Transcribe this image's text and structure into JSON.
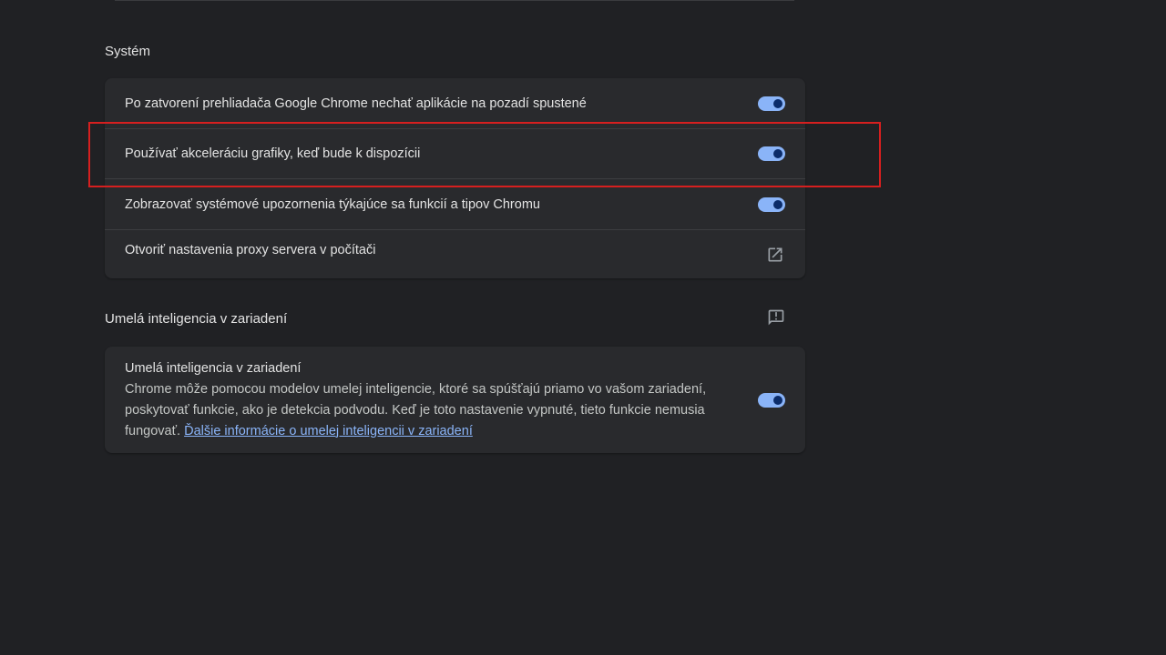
{
  "system": {
    "title": "Systém",
    "rows": [
      {
        "label": "Po zatvorení prehliadača Google Chrome nechať aplikácie na pozadí spustené",
        "enabled": true
      },
      {
        "label": "Používať akceleráciu grafiky, keď bude k dispozícii",
        "enabled": true
      },
      {
        "label": "Zobrazovať systémové upozornenia týkajúce sa funkcií a tipov Chromu",
        "enabled": true
      }
    ],
    "proxy_label": "Otvoriť nastavenia proxy servera v počítači",
    "proxy_icon": "open-in-new-icon"
  },
  "ai": {
    "title": "Umelá inteligencia v zariadení",
    "feedback_icon": "feedback-icon",
    "item_title": "Umelá inteligencia v zariadení",
    "item_desc": "Chrome môže pomocou modelov umelej inteligencie, ktoré sa spúšťajú priamo vo vašom zariadení, poskytovať funkcie, ako je detekcia podvodu. Keď je toto nastavenie vypnuté, tieto funkcie nemusia fungovať.",
    "item_link": "Ďalšie informácie o umelej inteligencii v zariadení",
    "enabled": true
  },
  "colors": {
    "background": "#202124",
    "card": "#292a2d",
    "accent": "#8ab4f8",
    "highlight": "#d61f1f"
  }
}
